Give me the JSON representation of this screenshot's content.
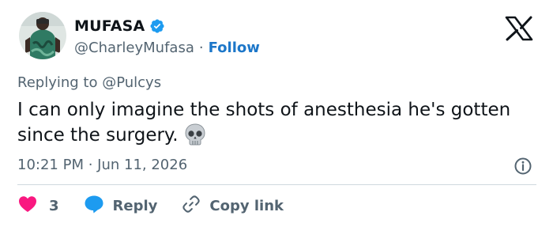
{
  "author": {
    "display_name": "MUFASA",
    "handle": "@CharleyMufasa",
    "separator": "·",
    "follow_label": "Follow"
  },
  "tweet": {
    "reply_prefix": "Replying to @Pulcys",
    "text": "I can only imagine the shots of anesthesia he's gotten since the surgery.",
    "emoji": "skull-icon",
    "timestamp": "10:21 PM · Jun 11, 2026"
  },
  "actions": {
    "like_count": "3",
    "reply_label": "Reply",
    "copy_link_label": "Copy link"
  },
  "colors": {
    "accent": "#1d9bf0",
    "like": "#f91880",
    "text": "#0f1419",
    "muted": "#536471",
    "follow": "#1d77c9"
  }
}
